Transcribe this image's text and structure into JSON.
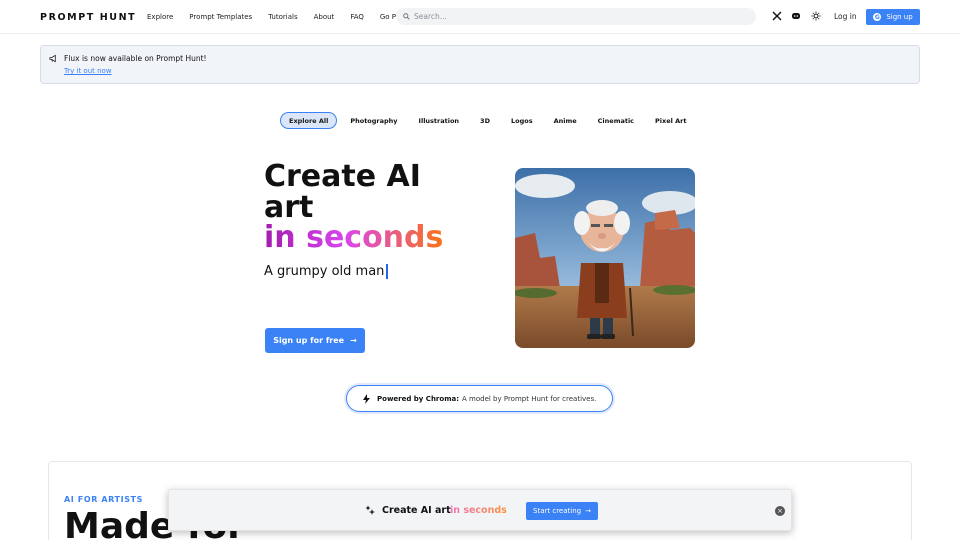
{
  "header": {
    "logo": "PROMPT HUNT",
    "nav": [
      "Explore",
      "Prompt Templates",
      "Tutorials",
      "About",
      "FAQ",
      "Go Pro"
    ],
    "search_placeholder": "Search...",
    "login": "Log in",
    "signup": "Sign up",
    "icons": [
      "x-icon",
      "discord-icon",
      "theme-toggle-icon"
    ]
  },
  "banner": {
    "message": "Flux is now available on Prompt Hunt!",
    "link": "Try it out now"
  },
  "categories": [
    "Explore All",
    "Photography",
    "Illustration",
    "3D",
    "Logos",
    "Anime",
    "Cinematic",
    "Pixel Art"
  ],
  "hero": {
    "title_line1": "Create AI",
    "title_line2": "art",
    "title_gradient": "in seconds",
    "typed_text": "A grumpy old man",
    "cta": "Sign up for free"
  },
  "powered": {
    "label": "Powered by Chroma:",
    "text": "A model by Prompt Hunt for creatives."
  },
  "lower": {
    "eyebrow": "AI FOR ARTISTS",
    "heading": "Made for"
  },
  "sticky": {
    "title": "Create AI art",
    "gradient": "in seconds",
    "button": "Start creating"
  },
  "colors": {
    "accent": "#3b82f6",
    "gradient_start": "#a21caf",
    "gradient_end": "#f97316"
  }
}
